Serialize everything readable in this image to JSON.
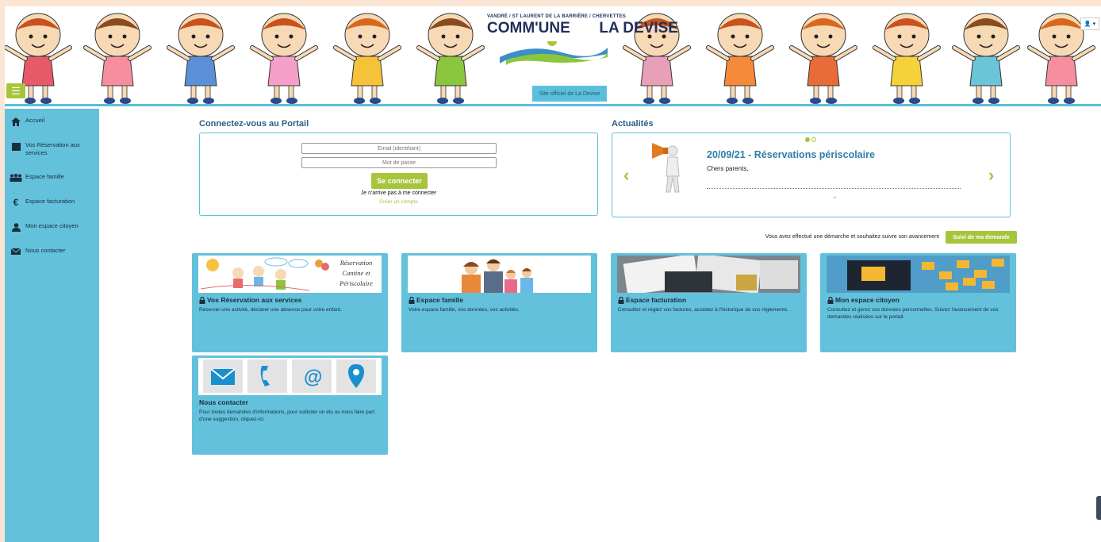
{
  "banner": {
    "logo_top": "VANDRÉ / ST LAURENT DE LA BARRIÈRE / CHERVETTES",
    "logo_main_left": "COMM'UNE",
    "logo_main_right": "LA DEVISE",
    "site_official": "Site officiel de La Devise",
    "menu_icon": "hamburger-icon",
    "user_icon": "user-icon"
  },
  "sidebar": {
    "items": [
      {
        "label": "Accueil",
        "icon": "home-icon"
      },
      {
        "label": "Vos Réservation aux services",
        "icon": "calendar-icon"
      },
      {
        "label": "Espace famille",
        "icon": "family-icon"
      },
      {
        "label": "Espace facturation",
        "icon": "euro-icon"
      },
      {
        "label": "Mon espace citoyen",
        "icon": "person-icon"
      },
      {
        "label": "Nous contacter",
        "icon": "envelope-icon"
      }
    ]
  },
  "login": {
    "title": "Connectez-vous au Portail",
    "email_placeholder": "Email (identifiant)",
    "password_placeholder": "Mot de passe",
    "connect_label": "Se connecter",
    "cant_connect": "Je n'arrive pas à me connecter",
    "create_account": "Créer un compte"
  },
  "news": {
    "title": "Actualités",
    "item_title": "20/09/21 - Réservations périscolaire",
    "item_text": "Chers parents,",
    "prev_label": "‹",
    "next_label": "›",
    "down_label": "⌄"
  },
  "tracking": {
    "text": "Vous avez effectué une démarche et souhaitez suivre son avancement",
    "button": "Suivi de ma demande"
  },
  "tiles": [
    {
      "title": "Vos Réservation aux services",
      "desc": "Réserver une activité, déclarer une absence pour votre enfant.",
      "img_lines": [
        "Réservation",
        "Cantine et",
        "Périscolaire"
      ],
      "locked": true
    },
    {
      "title": "Espace famille",
      "desc": "Votre espace famille, vos données, vos activités.",
      "locked": true
    },
    {
      "title": "Espace facturation",
      "desc": "Consultez et réglez vos factures, accédez à l'historique de vos règlements.",
      "locked": true
    },
    {
      "title": "Mon espace citoyen",
      "desc": "Consultez et gérez vos données personnelles. Suivez l'avancement de vos demandes réalisées sur le portail.",
      "locked": true
    },
    {
      "title": "Nous contacter",
      "desc": "Pour toutes demandes d'informations, pour solliciter un élu ou nous faire part d'une suggestion, cliquez-ici.",
      "locked": false
    }
  ],
  "colors": {
    "sidebar": "#63c1dc",
    "accent_green": "#a6c53b",
    "title_blue": "#2c5d86"
  }
}
